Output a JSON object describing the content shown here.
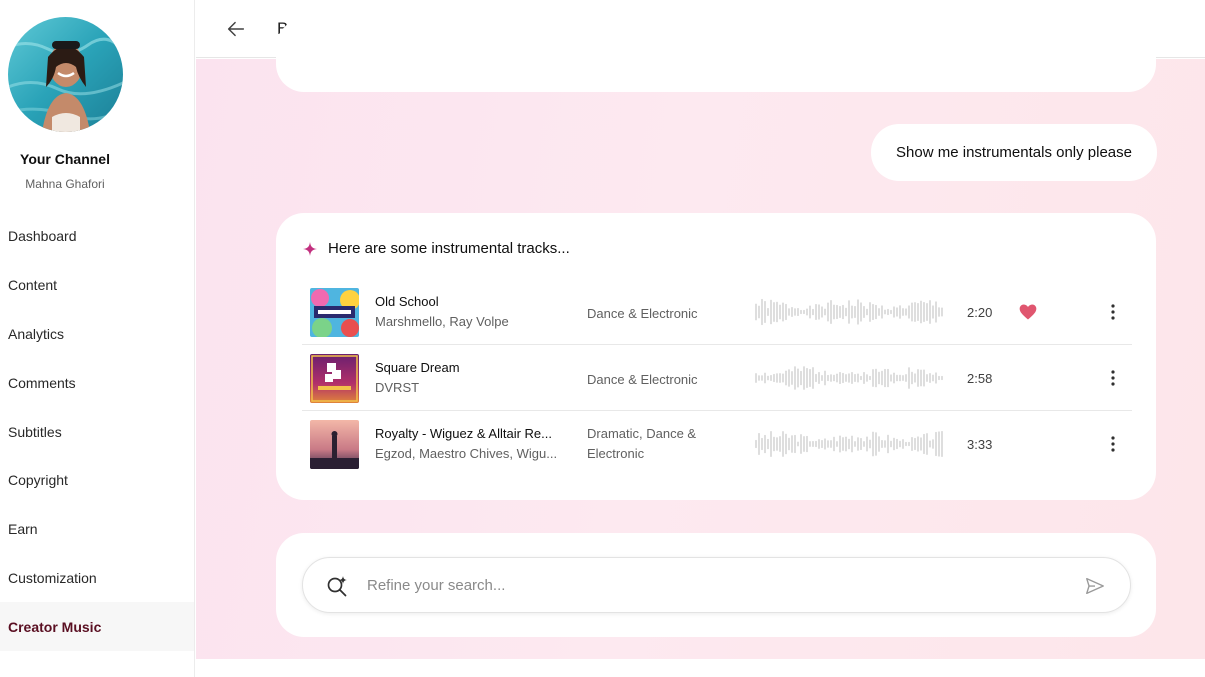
{
  "channel": {
    "title": "Your Channel",
    "name": "Mahna Ghafori"
  },
  "nav": {
    "items": [
      {
        "label": "Dashboard",
        "active": false
      },
      {
        "label": "Content",
        "active": false
      },
      {
        "label": "Analytics",
        "active": false
      },
      {
        "label": "Comments",
        "active": false
      },
      {
        "label": "Subtitles",
        "active": false
      },
      {
        "label": "Copyright",
        "active": false
      },
      {
        "label": "Earn",
        "active": false
      },
      {
        "label": "Customization",
        "active": false
      },
      {
        "label": "Creator Music",
        "active": true
      }
    ]
  },
  "topbar": {
    "back_label": "Back"
  },
  "chat": {
    "user_message": "Show me instrumentals only please",
    "result_title": "Here are some instrumental tracks...",
    "tracks": [
      {
        "title": "Old School",
        "artist": "Marshmello, Ray Volpe",
        "genre": "Dance & Electronic",
        "duration": "2:20",
        "liked": true
      },
      {
        "title": "Square Dream",
        "artist": "DVRST",
        "genre": "Dance & Electronic",
        "duration": "2:58",
        "liked": false
      },
      {
        "title": "Royalty - Wiguez & Alltair Re...",
        "artist": "Egzod, Maestro Chives, Wigu...",
        "genre": "Dramatic, Dance & Electronic",
        "duration": "3:33",
        "liked": false
      }
    ]
  },
  "search": {
    "placeholder": "Refine your search..."
  },
  "colors": {
    "accent": "#5a0f22",
    "heart": "#e0566f",
    "sparkle": "#c2307f"
  }
}
